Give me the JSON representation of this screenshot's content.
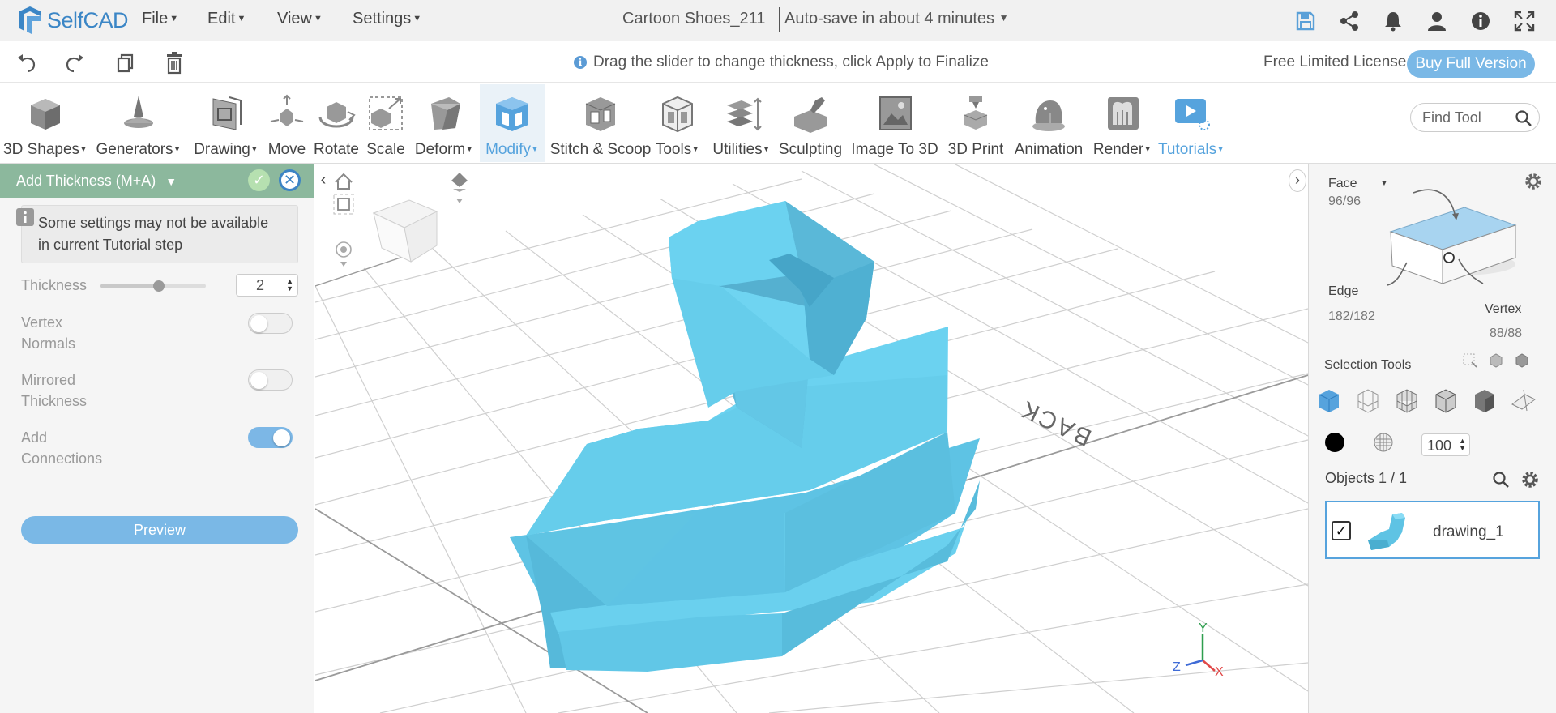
{
  "app": {
    "name": "SelfCAD"
  },
  "menu": [
    "File",
    "Edit",
    "View",
    "Settings"
  ],
  "project": {
    "title": "Cartoon Shoes_211",
    "autosave": "Auto-save in about 4 minutes"
  },
  "hint": "Drag the slider to change thickness, click Apply to Finalize",
  "license": {
    "text": "Free Limited License",
    "buy_label": "Buy Full Version"
  },
  "toolbar": {
    "tools": [
      {
        "label": "3D Shapes",
        "icon": "cube-icon",
        "dropdown": true
      },
      {
        "label": "Generators",
        "icon": "generator-icon",
        "dropdown": true
      },
      {
        "label": "Drawing",
        "icon": "drawing-icon",
        "dropdown": true
      },
      {
        "label": "Move",
        "icon": "move-icon",
        "dropdown": false
      },
      {
        "label": "Rotate",
        "icon": "rotate-icon",
        "dropdown": false
      },
      {
        "label": "Scale",
        "icon": "scale-icon",
        "dropdown": false
      },
      {
        "label": "Deform",
        "icon": "deform-icon",
        "dropdown": true
      },
      {
        "label": "Modify",
        "icon": "modify-icon",
        "dropdown": true
      },
      {
        "label": "Stitch & Scoop",
        "icon": "stitch-icon",
        "dropdown": false
      },
      {
        "label": "Tools",
        "icon": "tools-icon",
        "dropdown": true
      },
      {
        "label": "Utilities",
        "icon": "utilities-icon",
        "dropdown": true
      },
      {
        "label": "Sculpting",
        "icon": "sculpting-icon",
        "dropdown": false
      },
      {
        "label": "Image To 3D",
        "icon": "image-to-3d-icon",
        "dropdown": false
      },
      {
        "label": "3D Print",
        "icon": "print-icon",
        "dropdown": false
      },
      {
        "label": "Animation",
        "icon": "animation-icon",
        "dropdown": false
      },
      {
        "label": "Render",
        "icon": "render-icon",
        "dropdown": true
      },
      {
        "label": "Tutorials",
        "icon": "tutorials-icon",
        "dropdown": true
      }
    ],
    "find_placeholder": "Find Tool"
  },
  "panel": {
    "title": "Add Thickness (M+A)",
    "note": "Some settings may not be available in current Tutorial step",
    "thickness_label": "Thickness",
    "thickness_value": "2",
    "slider_fraction": 0.55,
    "vertex_normals_label": "Vertex Normals",
    "vertex_normals_on": false,
    "mirrored_label": "Mirrored Thickness",
    "mirrored_on": false,
    "connections_label": "Add Connections",
    "connections_on": true,
    "preview_label": "Preview"
  },
  "viewport": {
    "back_label": "BACK",
    "axis": {
      "y": "Y",
      "x": "X",
      "z": "Z"
    }
  },
  "selection": {
    "face_label": "Face",
    "face_count": "96/96",
    "edge_label": "Edge",
    "edge_count": "182/182",
    "vertex_label": "Vertex",
    "vertex_count": "88/88",
    "tools_label": "Selection Tools",
    "opacity": "100",
    "objects_label": "Objects 1 / 1",
    "object_name": "drawing_1"
  },
  "colors": {
    "accent": "#56a3dd",
    "model": "#66cdeb",
    "panel_head": "#8cb89d"
  }
}
